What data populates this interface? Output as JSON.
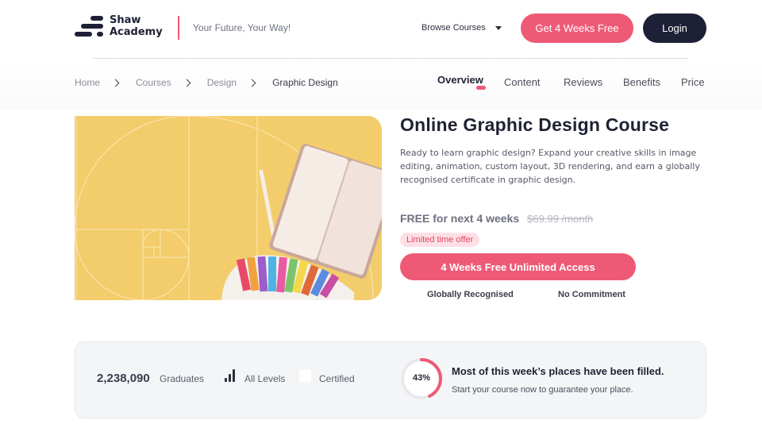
{
  "header": {
    "logo_line1": "Shaw",
    "logo_line2": "Academy",
    "tagline": "Your Future, Your Way!",
    "browse_label": "Browse Courses",
    "cta_label": "Get 4 Weeks Free",
    "login_label": "Login"
  },
  "breadcrumb": [
    "Home",
    "Courses",
    "Design",
    "Graphic Design"
  ],
  "tabs": [
    "Overview",
    "Content",
    "Reviews",
    "Benefits",
    "Price"
  ],
  "active_tab": "Overview",
  "course": {
    "title": "Online Graphic Design Course",
    "description": "Ready to learn graphic design? Expand your creative skills in image editing, animation, custom layout, 3D rendering, and earn a globally recognised certificate in graphic design.",
    "price_free": "FREE for next 4 weeks",
    "price_old": "$69.99 /month",
    "offer_badge": "Limited time offer",
    "access_button": "4 Weeks Free Unlimited Access",
    "feature_1": "Globally Recognised",
    "feature_2": "No Commitment"
  },
  "stats": {
    "graduates_count": "2,238,090",
    "graduates_label": "Graduates",
    "levels_label": "All Levels",
    "certified_label": "Certified",
    "filled_percent": 43,
    "filled_percent_label": "43%",
    "filled_title": "Most of this week’s places have been filled.",
    "filled_subtitle": "Start your course now to guarantee your place."
  },
  "colors": {
    "accent": "#ee5a76",
    "dark": "#1d2036",
    "hero_bg": "#f3cd6b"
  }
}
